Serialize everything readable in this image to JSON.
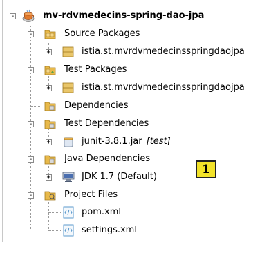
{
  "tree": {
    "root": {
      "label": "mv-rdvmedecins-spring-dao-jpa",
      "icon": "maven-project-icon"
    },
    "source_packages": {
      "label": "Source Packages",
      "icon": "source-folder-icon"
    },
    "source_package_item": {
      "label": "istia.st.mvrdvmedecinsspringdaojpa",
      "icon": "package-icon"
    },
    "test_packages": {
      "label": "Test Packages",
      "icon": "test-folder-icon"
    },
    "test_package_item": {
      "label": "istia.st.mvrdvmedecinsspringdaojpa",
      "icon": "package-icon"
    },
    "dependencies": {
      "label": "Dependencies",
      "icon": "dependencies-folder-icon"
    },
    "test_dependencies": {
      "label": "Test Dependencies",
      "icon": "dependencies-folder-icon"
    },
    "junit_jar": {
      "label": "junit-3.8.1.jar",
      "suffix": "[test]",
      "icon": "jar-icon"
    },
    "java_dependencies": {
      "label": "Java Dependencies",
      "icon": "dependencies-folder-icon"
    },
    "jdk": {
      "label": "JDK 1.7 (Default)",
      "icon": "jdk-icon"
    },
    "project_files": {
      "label": "Project Files",
      "icon": "project-files-folder-icon"
    },
    "pom_xml": {
      "label": "pom.xml",
      "icon": "xml-file-icon"
    },
    "settings_xml": {
      "label": "settings.xml",
      "icon": "xml-file-icon"
    },
    "toggle_expanded": "-",
    "toggle_collapsed": "+"
  },
  "annotation": {
    "label": "1"
  },
  "colors": {
    "folder": "#e8b94a",
    "package": "#e9c66a",
    "badge": "#f2e229",
    "xml": "#4a8fc8"
  }
}
